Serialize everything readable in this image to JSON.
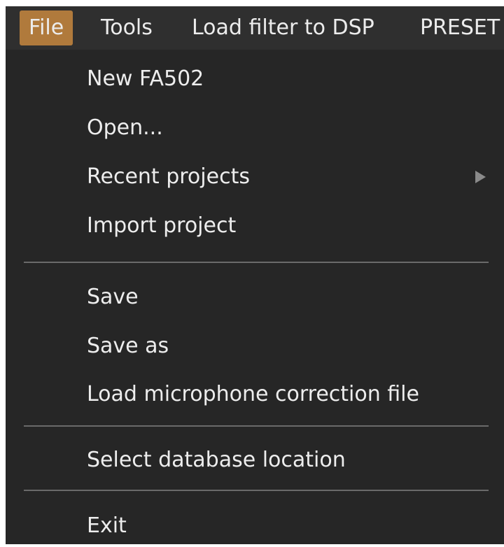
{
  "menubar": {
    "items": [
      {
        "label": "File"
      },
      {
        "label": "Tools"
      },
      {
        "label": "Load filter to DSP"
      },
      {
        "label": "PRESET"
      }
    ]
  },
  "file_menu": {
    "new": "New FA502",
    "open": "Open...",
    "recent": "Recent projects",
    "import": "Import project",
    "save": "Save",
    "save_as": "Save as",
    "load_mic": "Load microphone correction file",
    "select_db": "Select database location",
    "exit": "Exit"
  },
  "colors": {
    "active_menu": "#b07a3c",
    "menu_background": "#262626",
    "text": "#ededed"
  }
}
